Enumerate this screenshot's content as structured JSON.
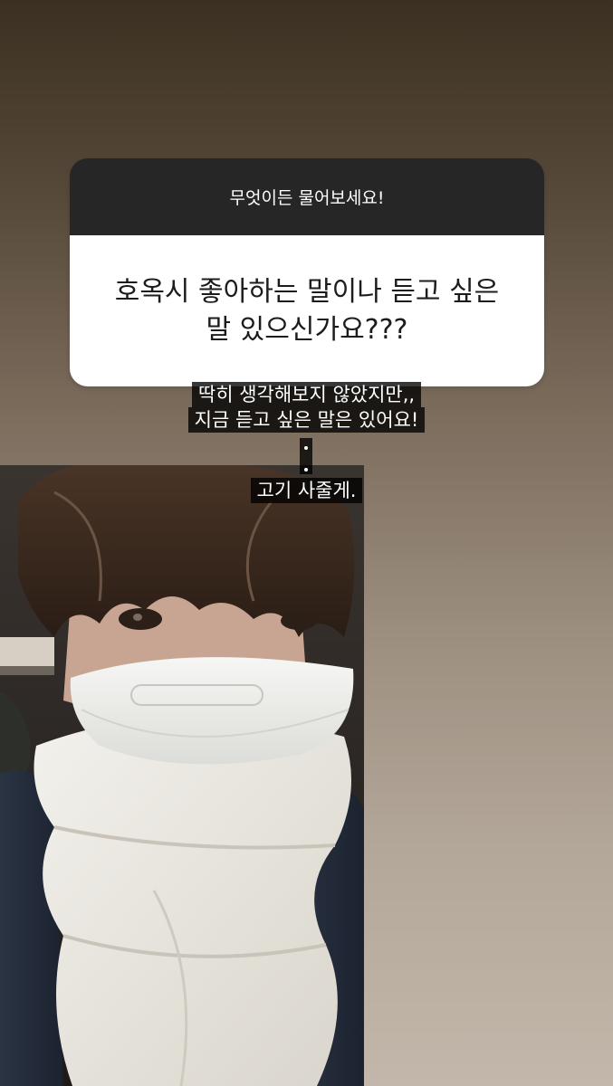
{
  "question": {
    "header": "무엇이든 물어보세요!",
    "text_line1": "호옥시 좋아하는 말이나 듣고 싶은",
    "text_line2": "말 있으신가요???"
  },
  "answer": {
    "line1": "딱히 생각해보지 않았지만,,",
    "line2": "지금 듣고 싶은 말은 있어요!",
    "final": "고기 사줄게."
  },
  "colors": {
    "header_bg": "#262626",
    "body_bg": "#ffffff",
    "caption_bg": "#000000c7"
  },
  "icons": [
    "selfie-photo"
  ]
}
